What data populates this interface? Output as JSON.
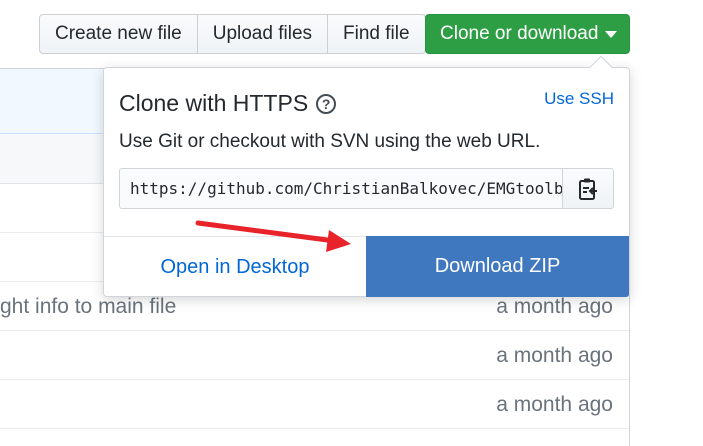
{
  "toolbar": {
    "create_label": "Create new file",
    "upload_label": "Upload files",
    "find_label": "Find file",
    "clone_label": "Clone or download"
  },
  "clone_panel": {
    "title": "Clone with HTTPS",
    "help_icon": "question-circle-icon",
    "ssh_link": "Use SSH",
    "description": "Use Git or checkout with SVN using the web URL.",
    "url_value": "https://github.com/ChristianBalkovec/EMGtoolbox.git",
    "copy_icon": "clipboard-icon",
    "open_desktop_label": "Open in Desktop",
    "download_zip_label": "Download ZIP"
  },
  "files": {
    "rows": [
      {
        "message": "ght info to main file",
        "age": "a month ago"
      },
      {
        "message": "",
        "age": "a month ago"
      },
      {
        "message": "",
        "age": "a month ago"
      }
    ]
  },
  "colors": {
    "primary_green": "#2e9e44",
    "link_blue": "#0366d6",
    "zip_blue": "#4078c0",
    "annotation_red": "#e8242a"
  }
}
